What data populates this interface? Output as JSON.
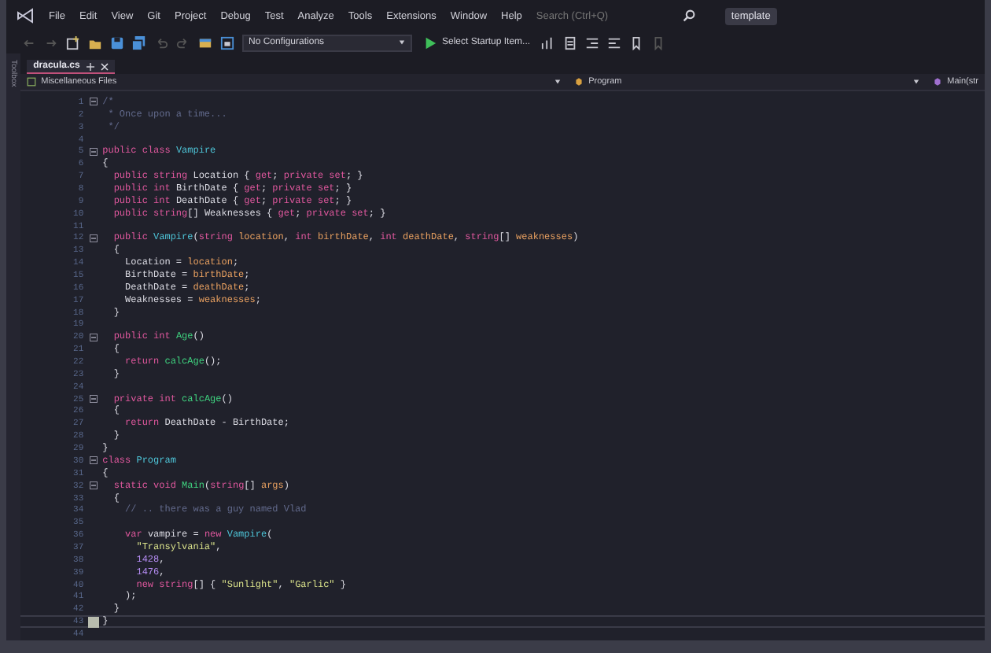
{
  "menu": {
    "items": [
      "File",
      "Edit",
      "View",
      "Git",
      "Project",
      "Debug",
      "Test",
      "Analyze",
      "Tools",
      "Extensions",
      "Window",
      "Help"
    ],
    "search": {
      "placeholder": "Search (Ctrl+Q)"
    },
    "badge": "template"
  },
  "toolbar": {
    "configuration": "No Configurations",
    "startup": "Select Startup Item..."
  },
  "sidebar_tab": "Toolbox",
  "tabs": [
    {
      "label": "dracula.cs",
      "selected": true
    }
  ],
  "navigation": {
    "project": "Miscellaneous Files",
    "type": "Program",
    "member": "Main(str"
  },
  "editor": {
    "lines": [
      {
        "number": "1",
        "fold": true,
        "current": false,
        "tokens": [
          {
            "kind": "comment",
            "text": "/*"
          }
        ]
      },
      {
        "number": "2",
        "fold": false,
        "current": false,
        "tokens": [
          {
            "kind": "comment",
            "text": " * Once upon a time..."
          }
        ]
      },
      {
        "number": "3",
        "fold": false,
        "current": false,
        "tokens": [
          {
            "kind": "comment",
            "text": " */"
          }
        ]
      },
      {
        "number": "4",
        "fold": false,
        "current": false
      },
      {
        "number": "5",
        "fold": true,
        "current": false,
        "tokens": [
          {
            "kind": "keyword",
            "text": "public class "
          },
          {
            "kind": "type",
            "text": "Vampire"
          }
        ]
      },
      {
        "number": "6",
        "fold": false,
        "current": false,
        "tokens": [
          {
            "kind": "plain",
            "text": "{"
          }
        ]
      },
      {
        "number": "7",
        "fold": false,
        "current": false,
        "tokens": [
          {
            "kind": "keyword",
            "text": "  public string "
          },
          {
            "kind": "plain",
            "text": "Location { "
          },
          {
            "kind": "keyword",
            "text": "get"
          },
          {
            "kind": "plain",
            "text": "; "
          },
          {
            "kind": "keyword",
            "text": "private set"
          },
          {
            "kind": "plain",
            "text": "; }"
          }
        ]
      },
      {
        "number": "8",
        "fold": false,
        "current": false,
        "tokens": [
          {
            "kind": "keyword",
            "text": "  public int "
          },
          {
            "kind": "plain",
            "text": "BirthDate { "
          },
          {
            "kind": "keyword",
            "text": "get"
          },
          {
            "kind": "plain",
            "text": "; "
          },
          {
            "kind": "keyword",
            "text": "private set"
          },
          {
            "kind": "plain",
            "text": "; }"
          }
        ]
      },
      {
        "number": "9",
        "fold": false,
        "current": false,
        "tokens": [
          {
            "kind": "keyword",
            "text": "  public int "
          },
          {
            "kind": "plain",
            "text": "DeathDate { "
          },
          {
            "kind": "keyword",
            "text": "get"
          },
          {
            "kind": "plain",
            "text": "; "
          },
          {
            "kind": "keyword",
            "text": "private set"
          },
          {
            "kind": "plain",
            "text": "; }"
          }
        ]
      },
      {
        "number": "10",
        "fold": false,
        "current": false,
        "tokens": [
          {
            "kind": "keyword",
            "text": "  public string"
          },
          {
            "kind": "plain",
            "text": "[] Weaknesses { "
          },
          {
            "kind": "keyword",
            "text": "get"
          },
          {
            "kind": "plain",
            "text": "; "
          },
          {
            "kind": "keyword",
            "text": "private set"
          },
          {
            "kind": "plain",
            "text": "; }"
          }
        ]
      },
      {
        "number": "11",
        "fold": false,
        "current": false
      },
      {
        "number": "12",
        "fold": true,
        "current": false,
        "tokens": [
          {
            "kind": "keyword",
            "text": "  public "
          },
          {
            "kind": "type",
            "text": "Vampire"
          },
          {
            "kind": "plain",
            "text": "("
          },
          {
            "kind": "keyword",
            "text": "string "
          },
          {
            "kind": "parameter",
            "text": "location"
          },
          {
            "kind": "plain",
            "text": ", "
          },
          {
            "kind": "keyword",
            "text": "int "
          },
          {
            "kind": "parameter",
            "text": "birthDate"
          },
          {
            "kind": "plain",
            "text": ", "
          },
          {
            "kind": "keyword",
            "text": "int "
          },
          {
            "kind": "parameter",
            "text": "deathDate"
          },
          {
            "kind": "plain",
            "text": ", "
          },
          {
            "kind": "keyword",
            "text": "string"
          },
          {
            "kind": "plain",
            "text": "[] "
          },
          {
            "kind": "parameter",
            "text": "weaknesses"
          },
          {
            "kind": "plain",
            "text": ")"
          }
        ]
      },
      {
        "number": "13",
        "fold": false,
        "current": false,
        "tokens": [
          {
            "kind": "plain",
            "text": "  {"
          }
        ]
      },
      {
        "number": "14",
        "fold": false,
        "current": false,
        "tokens": [
          {
            "kind": "plain",
            "text": "    Location = "
          },
          {
            "kind": "parameter",
            "text": "location"
          },
          {
            "kind": "plain",
            "text": ";"
          }
        ]
      },
      {
        "number": "15",
        "fold": false,
        "current": false,
        "tokens": [
          {
            "kind": "plain",
            "text": "    BirthDate = "
          },
          {
            "kind": "parameter",
            "text": "birthDate"
          },
          {
            "kind": "plain",
            "text": ";"
          }
        ]
      },
      {
        "number": "16",
        "fold": false,
        "current": false,
        "tokens": [
          {
            "kind": "plain",
            "text": "    DeathDate = "
          },
          {
            "kind": "parameter",
            "text": "deathDate"
          },
          {
            "kind": "plain",
            "text": ";"
          }
        ]
      },
      {
        "number": "17",
        "fold": false,
        "current": false,
        "tokens": [
          {
            "kind": "plain",
            "text": "    Weaknesses = "
          },
          {
            "kind": "parameter",
            "text": "weaknesses"
          },
          {
            "kind": "plain",
            "text": ";"
          }
        ]
      },
      {
        "number": "18",
        "fold": false,
        "current": false,
        "tokens": [
          {
            "kind": "plain",
            "text": "  }"
          }
        ]
      },
      {
        "number": "19",
        "fold": false,
        "current": false
      },
      {
        "number": "20",
        "fold": true,
        "current": false,
        "tokens": [
          {
            "kind": "keyword",
            "text": "  public int "
          },
          {
            "kind": "method",
            "text": "Age"
          },
          {
            "kind": "plain",
            "text": "()"
          }
        ]
      },
      {
        "number": "21",
        "fold": false,
        "current": false,
        "tokens": [
          {
            "kind": "plain",
            "text": "  {"
          }
        ]
      },
      {
        "number": "22",
        "fold": false,
        "current": false,
        "tokens": [
          {
            "kind": "keyword",
            "text": "    return "
          },
          {
            "kind": "method",
            "text": "calcAge"
          },
          {
            "kind": "plain",
            "text": "();"
          }
        ]
      },
      {
        "number": "23",
        "fold": false,
        "current": false,
        "tokens": [
          {
            "kind": "plain",
            "text": "  }"
          }
        ]
      },
      {
        "number": "24",
        "fold": false,
        "current": false
      },
      {
        "number": "25",
        "fold": true,
        "current": false,
        "tokens": [
          {
            "kind": "keyword",
            "text": "  private int "
          },
          {
            "kind": "method",
            "text": "calcAge"
          },
          {
            "kind": "plain",
            "text": "()"
          }
        ]
      },
      {
        "number": "26",
        "fold": false,
        "current": false,
        "tokens": [
          {
            "kind": "plain",
            "text": "  {"
          }
        ]
      },
      {
        "number": "27",
        "fold": false,
        "current": false,
        "tokens": [
          {
            "kind": "keyword",
            "text": "    return "
          },
          {
            "kind": "plain",
            "text": "DeathDate - BirthDate;"
          }
        ]
      },
      {
        "number": "28",
        "fold": false,
        "current": false,
        "tokens": [
          {
            "kind": "plain",
            "text": "  }"
          }
        ]
      },
      {
        "number": "29",
        "fold": false,
        "current": false,
        "tokens": [
          {
            "kind": "plain",
            "text": "}"
          }
        ]
      },
      {
        "number": "30",
        "fold": true,
        "current": false,
        "tokens": [
          {
            "kind": "keyword",
            "text": "class "
          },
          {
            "kind": "type",
            "text": "Program"
          }
        ]
      },
      {
        "number": "31",
        "fold": false,
        "current": false,
        "tokens": [
          {
            "kind": "plain",
            "text": "{"
          }
        ]
      },
      {
        "number": "32",
        "fold": true,
        "current": false,
        "tokens": [
          {
            "kind": "keyword",
            "text": "  static void "
          },
          {
            "kind": "method",
            "text": "Main"
          },
          {
            "kind": "plain",
            "text": "("
          },
          {
            "kind": "keyword",
            "text": "string"
          },
          {
            "kind": "plain",
            "text": "[] "
          },
          {
            "kind": "parameter",
            "text": "args"
          },
          {
            "kind": "plain",
            "text": ")"
          }
        ]
      },
      {
        "number": "33",
        "fold": false,
        "current": false,
        "tokens": [
          {
            "kind": "plain",
            "text": "  {"
          }
        ]
      },
      {
        "number": "34",
        "fold": false,
        "current": false,
        "tokens": [
          {
            "kind": "comment",
            "text": "    // .. there was a guy named Vlad"
          }
        ]
      },
      {
        "number": "35",
        "fold": false,
        "current": false
      },
      {
        "number": "36",
        "fold": false,
        "current": false,
        "tokens": [
          {
            "kind": "keyword",
            "text": "    var "
          },
          {
            "kind": "plain",
            "text": "vampire = "
          },
          {
            "kind": "keyword",
            "text": "new "
          },
          {
            "kind": "type",
            "text": "Vampire"
          },
          {
            "kind": "plain",
            "text": "("
          }
        ]
      },
      {
        "number": "37",
        "fold": false,
        "current": false,
        "tokens": [
          {
            "kind": "string",
            "text": "      \"Transylvania\""
          },
          {
            "kind": "plain",
            "text": ","
          }
        ]
      },
      {
        "number": "38",
        "fold": false,
        "current": false,
        "tokens": [
          {
            "kind": "number",
            "text": "      1428"
          },
          {
            "kind": "plain",
            "text": ","
          }
        ]
      },
      {
        "number": "39",
        "fold": false,
        "current": false,
        "tokens": [
          {
            "kind": "number",
            "text": "      1476"
          },
          {
            "kind": "plain",
            "text": ","
          }
        ]
      },
      {
        "number": "40",
        "fold": false,
        "current": false,
        "tokens": [
          {
            "kind": "keyword",
            "text": "      new string"
          },
          {
            "kind": "plain",
            "text": "[] { "
          },
          {
            "kind": "string",
            "text": "\"Sunlight\""
          },
          {
            "kind": "plain",
            "text": ", "
          },
          {
            "kind": "string",
            "text": "\"Garlic\""
          },
          {
            "kind": "plain",
            "text": " }"
          }
        ]
      },
      {
        "number": "41",
        "fold": false,
        "current": false,
        "tokens": [
          {
            "kind": "plain",
            "text": "    );"
          }
        ]
      },
      {
        "number": "42",
        "fold": false,
        "current": false,
        "tokens": [
          {
            "kind": "plain",
            "text": "  }"
          }
        ]
      },
      {
        "number": "43",
        "fold": false,
        "current": true,
        "tokens": [
          {
            "kind": "plain",
            "text": "}"
          }
        ]
      },
      {
        "number": "44",
        "fold": false,
        "current": false
      }
    ]
  }
}
